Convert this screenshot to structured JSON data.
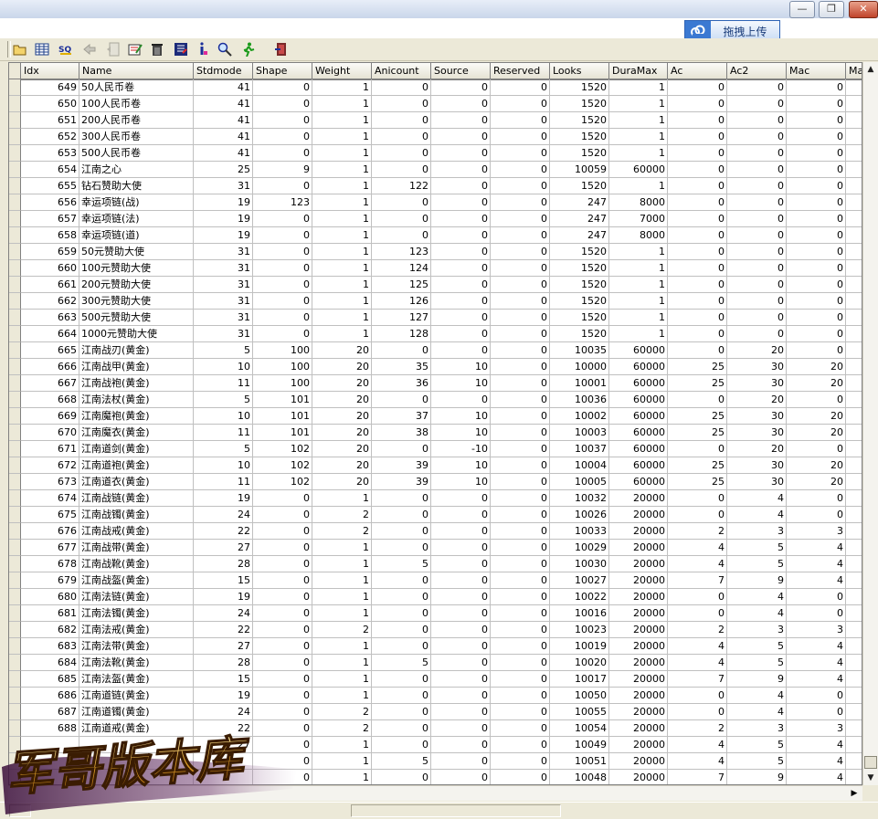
{
  "upload_button": {
    "label": "拖拽上传"
  },
  "window_buttons": {
    "minimize": "—",
    "restore": "❐",
    "close": "✕"
  },
  "toolbar": {
    "icons": [
      "open-folder-icon",
      "table-grid-icon",
      "sql-query-icon",
      "back-arrow-icon",
      "document-disabled-icon",
      "edit-table-icon",
      "delete-trash-icon",
      "import-icon",
      "info-icon",
      "find-icon",
      "run-icon",
      "exit-icon"
    ]
  },
  "grid": {
    "columns": [
      "Idx",
      "Name",
      "Stdmode",
      "Shape",
      "Weight",
      "Anicount",
      "Source",
      "Reserved",
      "Looks",
      "DuraMax",
      "Ac",
      "Ac2",
      "Mac",
      "Ma"
    ],
    "rows": [
      [
        "649",
        "50人民币卷",
        "41",
        "0",
        "1",
        "0",
        "0",
        "0",
        "1520",
        "1",
        "0",
        "0",
        "0"
      ],
      [
        "650",
        "100人民币卷",
        "41",
        "0",
        "1",
        "0",
        "0",
        "0",
        "1520",
        "1",
        "0",
        "0",
        "0"
      ],
      [
        "651",
        "200人民币卷",
        "41",
        "0",
        "1",
        "0",
        "0",
        "0",
        "1520",
        "1",
        "0",
        "0",
        "0"
      ],
      [
        "652",
        "300人民币卷",
        "41",
        "0",
        "1",
        "0",
        "0",
        "0",
        "1520",
        "1",
        "0",
        "0",
        "0"
      ],
      [
        "653",
        "500人民币卷",
        "41",
        "0",
        "1",
        "0",
        "0",
        "0",
        "1520",
        "1",
        "0",
        "0",
        "0"
      ],
      [
        "654",
        "江南之心",
        "25",
        "9",
        "1",
        "0",
        "0",
        "0",
        "10059",
        "60000",
        "0",
        "0",
        "0"
      ],
      [
        "655",
        "钻石赞助大使",
        "31",
        "0",
        "1",
        "122",
        "0",
        "0",
        "1520",
        "1",
        "0",
        "0",
        "0"
      ],
      [
        "656",
        "幸运项链(战)",
        "19",
        "123",
        "1",
        "0",
        "0",
        "0",
        "247",
        "8000",
        "0",
        "0",
        "0"
      ],
      [
        "657",
        "幸运项链(法)",
        "19",
        "0",
        "1",
        "0",
        "0",
        "0",
        "247",
        "7000",
        "0",
        "0",
        "0"
      ],
      [
        "658",
        "幸运项链(道)",
        "19",
        "0",
        "1",
        "0",
        "0",
        "0",
        "247",
        "8000",
        "0",
        "0",
        "0"
      ],
      [
        "659",
        "50元赞助大使",
        "31",
        "0",
        "1",
        "123",
        "0",
        "0",
        "1520",
        "1",
        "0",
        "0",
        "0"
      ],
      [
        "660",
        "100元赞助大使",
        "31",
        "0",
        "1",
        "124",
        "0",
        "0",
        "1520",
        "1",
        "0",
        "0",
        "0"
      ],
      [
        "661",
        "200元赞助大使",
        "31",
        "0",
        "1",
        "125",
        "0",
        "0",
        "1520",
        "1",
        "0",
        "0",
        "0"
      ],
      [
        "662",
        "300元赞助大使",
        "31",
        "0",
        "1",
        "126",
        "0",
        "0",
        "1520",
        "1",
        "0",
        "0",
        "0"
      ],
      [
        "663",
        "500元赞助大使",
        "31",
        "0",
        "1",
        "127",
        "0",
        "0",
        "1520",
        "1",
        "0",
        "0",
        "0"
      ],
      [
        "664",
        "1000元赞助大使",
        "31",
        "0",
        "1",
        "128",
        "0",
        "0",
        "1520",
        "1",
        "0",
        "0",
        "0"
      ],
      [
        "665",
        "江南战刃(黄金)",
        "5",
        "100",
        "20",
        "0",
        "0",
        "0",
        "10035",
        "60000",
        "0",
        "20",
        "0"
      ],
      [
        "666",
        "江南战甲(黄金)",
        "10",
        "100",
        "20",
        "35",
        "10",
        "0",
        "10000",
        "60000",
        "25",
        "30",
        "20"
      ],
      [
        "667",
        "江南战袍(黄金)",
        "11",
        "100",
        "20",
        "36",
        "10",
        "0",
        "10001",
        "60000",
        "25",
        "30",
        "20"
      ],
      [
        "668",
        "江南法杖(黄金)",
        "5",
        "101",
        "20",
        "0",
        "0",
        "0",
        "10036",
        "60000",
        "0",
        "20",
        "0"
      ],
      [
        "669",
        "江南魔袍(黄金)",
        "10",
        "101",
        "20",
        "37",
        "10",
        "0",
        "10002",
        "60000",
        "25",
        "30",
        "20"
      ],
      [
        "670",
        "江南魔衣(黄金)",
        "11",
        "101",
        "20",
        "38",
        "10",
        "0",
        "10003",
        "60000",
        "25",
        "30",
        "20"
      ],
      [
        "671",
        "江南道剑(黄金)",
        "5",
        "102",
        "20",
        "0",
        "-10",
        "0",
        "10037",
        "60000",
        "0",
        "20",
        "0"
      ],
      [
        "672",
        "江南道袍(黄金)",
        "10",
        "102",
        "20",
        "39",
        "10",
        "0",
        "10004",
        "60000",
        "25",
        "30",
        "20"
      ],
      [
        "673",
        "江南道衣(黄金)",
        "11",
        "102",
        "20",
        "39",
        "10",
        "0",
        "10005",
        "60000",
        "25",
        "30",
        "20"
      ],
      [
        "674",
        "江南战链(黄金)",
        "19",
        "0",
        "1",
        "0",
        "0",
        "0",
        "10032",
        "20000",
        "0",
        "4",
        "0"
      ],
      [
        "675",
        "江南战镯(黄金)",
        "24",
        "0",
        "2",
        "0",
        "0",
        "0",
        "10026",
        "20000",
        "0",
        "4",
        "0"
      ],
      [
        "676",
        "江南战戒(黄金)",
        "22",
        "0",
        "2",
        "0",
        "0",
        "0",
        "10033",
        "20000",
        "2",
        "3",
        "3"
      ],
      [
        "677",
        "江南战带(黄金)",
        "27",
        "0",
        "1",
        "0",
        "0",
        "0",
        "10029",
        "20000",
        "4",
        "5",
        "4"
      ],
      [
        "678",
        "江南战靴(黄金)",
        "28",
        "0",
        "1",
        "5",
        "0",
        "0",
        "10030",
        "20000",
        "4",
        "5",
        "4"
      ],
      [
        "679",
        "江南战盔(黄金)",
        "15",
        "0",
        "1",
        "0",
        "0",
        "0",
        "10027",
        "20000",
        "7",
        "9",
        "4"
      ],
      [
        "680",
        "江南法链(黄金)",
        "19",
        "0",
        "1",
        "0",
        "0",
        "0",
        "10022",
        "20000",
        "0",
        "4",
        "0"
      ],
      [
        "681",
        "江南法镯(黄金)",
        "24",
        "0",
        "1",
        "0",
        "0",
        "0",
        "10016",
        "20000",
        "0",
        "4",
        "0"
      ],
      [
        "682",
        "江南法戒(黄金)",
        "22",
        "0",
        "2",
        "0",
        "0",
        "0",
        "10023",
        "20000",
        "2",
        "3",
        "3"
      ],
      [
        "683",
        "江南法带(黄金)",
        "27",
        "0",
        "1",
        "0",
        "0",
        "0",
        "10019",
        "20000",
        "4",
        "5",
        "4"
      ],
      [
        "684",
        "江南法靴(黄金)",
        "28",
        "0",
        "1",
        "5",
        "0",
        "0",
        "10020",
        "20000",
        "4",
        "5",
        "4"
      ],
      [
        "685",
        "江南法盔(黄金)",
        "15",
        "0",
        "1",
        "0",
        "0",
        "0",
        "10017",
        "20000",
        "7",
        "9",
        "4"
      ],
      [
        "686",
        "江南道链(黄金)",
        "19",
        "0",
        "1",
        "0",
        "0",
        "0",
        "10050",
        "20000",
        "0",
        "4",
        "0"
      ],
      [
        "687",
        "江南道镯(黄金)",
        "24",
        "0",
        "2",
        "0",
        "0",
        "0",
        "10055",
        "20000",
        "0",
        "4",
        "0"
      ],
      [
        "688",
        "江南道戒(黄金)",
        "22",
        "0",
        "2",
        "0",
        "0",
        "0",
        "10054",
        "20000",
        "2",
        "3",
        "3"
      ],
      [
        "",
        "",
        "27",
        "0",
        "1",
        "0",
        "0",
        "0",
        "10049",
        "20000",
        "4",
        "5",
        "4"
      ],
      [
        "",
        "",
        "",
        "0",
        "1",
        "5",
        "0",
        "0",
        "10051",
        "20000",
        "4",
        "5",
        "4"
      ],
      [
        "",
        "",
        "",
        "0",
        "1",
        "0",
        "0",
        "0",
        "10048",
        "20000",
        "7",
        "9",
        "4"
      ]
    ]
  },
  "watermark": {
    "text": "军哥版本库"
  }
}
